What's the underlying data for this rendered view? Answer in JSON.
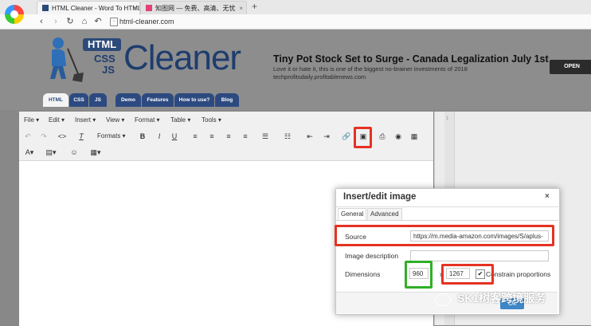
{
  "browser": {
    "tabs": [
      {
        "label": "HTML Cleaner - Word To HTML",
        "close": "×"
      },
      {
        "label": "知图网 — 免费、高清、无忧",
        "close": "×"
      }
    ],
    "new_tab": "+",
    "url": "html-cleaner.com",
    "nav": {
      "back": "‹",
      "forward": "›",
      "reload": "↻",
      "home": "⌂",
      "undo": "↶",
      "star": "☆"
    }
  },
  "site": {
    "logo": {
      "html": "HTML",
      "css": "CSS",
      "js": "JS",
      "cleaner": "Cleaner"
    },
    "ad": {
      "title": "Tiny Pot Stock Set to Surge - Canada Legalization July 1st",
      "text": "Love it or hate it, this is one of the biggest no-brainer investments of 2018",
      "source": "techprofitsdaily.profitablenews.com",
      "button": "OPEN"
    },
    "tabs": [
      "HTML",
      "CSS",
      "JS",
      "Demo",
      "Features",
      "How to use?",
      "Blog"
    ]
  },
  "editor": {
    "menu": [
      "File ▾",
      "Edit ▾",
      "Insert ▾",
      "View ▾",
      "Format ▾",
      "Table ▾",
      "Tools ▾"
    ],
    "formats": "Formats ▾",
    "gutter_label": "1"
  },
  "dialog": {
    "title": "Insert/edit image",
    "close": "×",
    "tabs": [
      "General",
      "Advanced"
    ],
    "source_label": "Source",
    "source_value": "https://m.media-amazon.com/images/S/aplus-",
    "description_label": "Image description",
    "description_value": "",
    "dimensions_label": "Dimensions",
    "width": "960",
    "separator": "x",
    "height": "1267",
    "constrain_label": "Constrain proportions",
    "constrain_checked": "✔",
    "ok": "Ok"
  },
  "watermark": "SK1树客跨境服务",
  "colors": {
    "highlight_red": "#e53222",
    "highlight_green": "#31b026",
    "brand": "#1e3d6e"
  }
}
